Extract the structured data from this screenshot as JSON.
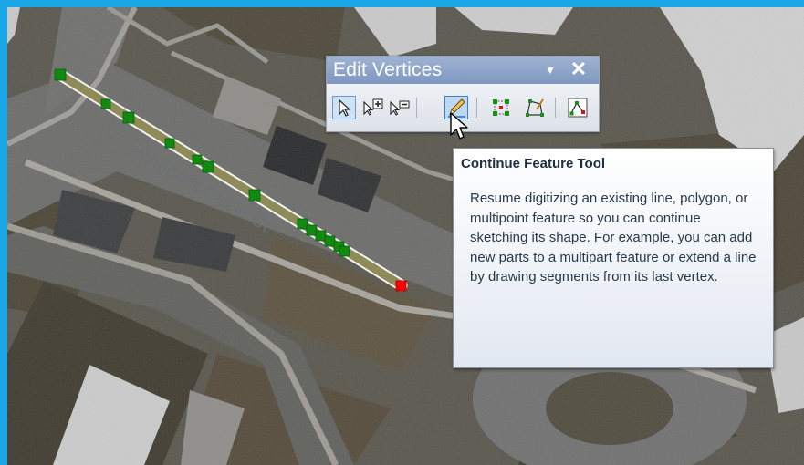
{
  "toolbar": {
    "title": "Edit Vertices",
    "menu_glyph": "▼",
    "close_glyph": "✕",
    "tools": [
      {
        "id": "edit-tool",
        "icon": "pointer-arrow-icon"
      },
      {
        "id": "add-vertex",
        "icon": "add-vertex-icon"
      },
      {
        "id": "delete-vertex",
        "icon": "delete-vertex-icon"
      },
      {
        "id": "continue-feature",
        "icon": "pencil-icon",
        "active": true
      },
      {
        "id": "modify-selection",
        "icon": "vertex-box-icon"
      },
      {
        "id": "reshape",
        "icon": "reshape-icon"
      },
      {
        "id": "sketch-properties",
        "icon": "sketch-properties-icon"
      }
    ]
  },
  "tooltip": {
    "title": "Continue Feature Tool",
    "body": "Resume digitizing an existing line, polygon, or multipoint feature so you can continue sketching its shape. For example, you can add new parts to a multipart feature or extend a line by drawing segments from its last vertex."
  },
  "map": {
    "street_label": "Winners Circle Ct",
    "colors": {
      "line": "#8e8b58",
      "vertex": "#118a11",
      "last_vertex": "#ff0000",
      "frame": "#1aa7e8"
    }
  }
}
